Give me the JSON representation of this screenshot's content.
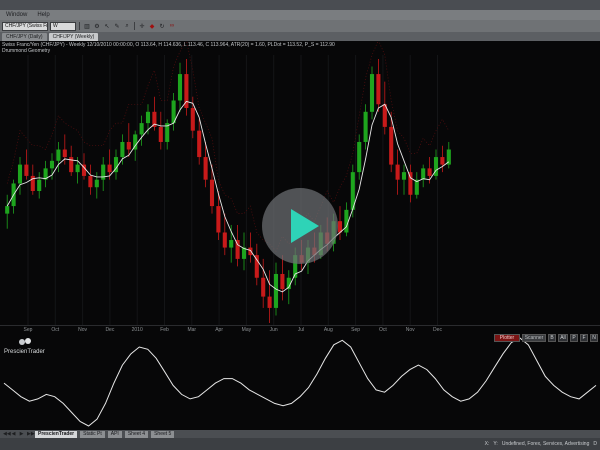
{
  "menu": {
    "items": [
      "Window",
      "Help"
    ]
  },
  "toolbar": {
    "symbol": "CHF/JPY (Swiss Fr",
    "interval": "W",
    "icons": [
      "chart-icon",
      "settings-icon",
      "pointer-icon",
      "drawing-icon",
      "zoom-icon",
      "crosshair-icon",
      "color-icon",
      "refresh-icon",
      "link-icon"
    ]
  },
  "tabs": [
    {
      "label": "CHF/JPY (Daily)"
    },
    {
      "label": "CHF/JPY (Weekly)"
    }
  ],
  "chart_header": {
    "line1": "Swiss Franc/Yen (CHF/JPY) - Weekly 12/10/2010 00:00:00, O 113.64, H 114.636, L 113.46, C 113.964, ATR(20) = 1.60, PLDot = 113.52, P_S = 112.90",
    "line2": "Drummond Geometry"
  },
  "date_axis": [
    "Sep",
    "Oct",
    "Nov",
    "Dec",
    "2010",
    "Feb",
    "Mar",
    "Apr",
    "May",
    "Jun",
    "Jul",
    "Aug",
    "Sep",
    "Oct",
    "Nov",
    "Dec"
  ],
  "panel_buttons": {
    "plotter": "Plotter",
    "scanner": "Scanner",
    "b": "B",
    "all": "All",
    "p": "P",
    "f": "F",
    "n": "N"
  },
  "logo_text": "PrescienTrader",
  "sheets": {
    "nav": [
      "◀◀",
      "◀",
      "▶",
      "▶▶"
    ],
    "tabs": [
      "PrescienTrader",
      "Static Pt",
      "API",
      "Sheet 4",
      "Sheet 5"
    ]
  },
  "status": {
    "x": "X:",
    "y": "Y:",
    "label": "Undefined, Forex, Services, Advertising",
    "end": "D"
  },
  "colors": {
    "bull": "#1ea51e",
    "bear": "#c81a1a",
    "background": "#070708",
    "accent_play": "#2ed3b7"
  },
  "chart_data": {
    "type": "candlestick",
    "candles": [
      {
        "o": 95,
        "h": 100,
        "l": 91,
        "c": 97
      },
      {
        "o": 97,
        "h": 104,
        "l": 95,
        "c": 103
      },
      {
        "o": 103,
        "h": 110,
        "l": 100,
        "c": 108
      },
      {
        "o": 108,
        "h": 112,
        "l": 104,
        "c": 105
      },
      {
        "o": 105,
        "h": 108,
        "l": 100,
        "c": 101
      },
      {
        "o": 101,
        "h": 106,
        "l": 99,
        "c": 104
      },
      {
        "o": 104,
        "h": 109,
        "l": 102,
        "c": 107
      },
      {
        "o": 107,
        "h": 111,
        "l": 104,
        "c": 109
      },
      {
        "o": 109,
        "h": 114,
        "l": 106,
        "c": 112
      },
      {
        "o": 112,
        "h": 116,
        "l": 108,
        "c": 110
      },
      {
        "o": 110,
        "h": 113,
        "l": 105,
        "c": 106
      },
      {
        "o": 106,
        "h": 110,
        "l": 103,
        "c": 108
      },
      {
        "o": 108,
        "h": 111,
        "l": 104,
        "c": 105
      },
      {
        "o": 105,
        "h": 108,
        "l": 100,
        "c": 102
      },
      {
        "o": 102,
        "h": 106,
        "l": 99,
        "c": 104
      },
      {
        "o": 104,
        "h": 110,
        "l": 101,
        "c": 108
      },
      {
        "o": 108,
        "h": 112,
        "l": 104,
        "c": 106
      },
      {
        "o": 106,
        "h": 112,
        "l": 104,
        "c": 110
      },
      {
        "o": 110,
        "h": 116,
        "l": 108,
        "c": 114
      },
      {
        "o": 114,
        "h": 119,
        "l": 110,
        "c": 112
      },
      {
        "o": 112,
        "h": 117,
        "l": 109,
        "c": 116
      },
      {
        "o": 116,
        "h": 121,
        "l": 113,
        "c": 119
      },
      {
        "o": 119,
        "h": 124,
        "l": 116,
        "c": 122
      },
      {
        "o": 122,
        "h": 126,
        "l": 117,
        "c": 118
      },
      {
        "o": 118,
        "h": 122,
        "l": 112,
        "c": 114
      },
      {
        "o": 114,
        "h": 120,
        "l": 112,
        "c": 119
      },
      {
        "o": 119,
        "h": 127,
        "l": 117,
        "c": 125
      },
      {
        "o": 125,
        "h": 135,
        "l": 122,
        "c": 132
      },
      {
        "o": 132,
        "h": 136,
        "l": 121,
        "c": 123
      },
      {
        "o": 123,
        "h": 126,
        "l": 115,
        "c": 117
      },
      {
        "o": 117,
        "h": 120,
        "l": 108,
        "c": 110
      },
      {
        "o": 110,
        "h": 114,
        "l": 102,
        "c": 104
      },
      {
        "o": 104,
        "h": 108,
        "l": 95,
        "c": 97
      },
      {
        "o": 97,
        "h": 101,
        "l": 88,
        "c": 90
      },
      {
        "o": 90,
        "h": 95,
        "l": 84,
        "c": 86
      },
      {
        "o": 86,
        "h": 92,
        "l": 82,
        "c": 88
      },
      {
        "o": 88,
        "h": 92,
        "l": 81,
        "c": 83
      },
      {
        "o": 83,
        "h": 90,
        "l": 80,
        "c": 86
      },
      {
        "o": 86,
        "h": 90,
        "l": 82,
        "c": 84
      },
      {
        "o": 84,
        "h": 87,
        "l": 76,
        "c": 78
      },
      {
        "o": 78,
        "h": 83,
        "l": 70,
        "c": 73
      },
      {
        "o": 73,
        "h": 80,
        "l": 66,
        "c": 70
      },
      {
        "o": 70,
        "h": 82,
        "l": 68,
        "c": 79
      },
      {
        "o": 79,
        "h": 84,
        "l": 72,
        "c": 75
      },
      {
        "o": 75,
        "h": 80,
        "l": 71,
        "c": 78
      },
      {
        "o": 78,
        "h": 86,
        "l": 76,
        "c": 84
      },
      {
        "o": 84,
        "h": 88,
        "l": 80,
        "c": 82
      },
      {
        "o": 82,
        "h": 88,
        "l": 79,
        "c": 86
      },
      {
        "o": 86,
        "h": 90,
        "l": 82,
        "c": 84
      },
      {
        "o": 84,
        "h": 92,
        "l": 83,
        "c": 90
      },
      {
        "o": 90,
        "h": 94,
        "l": 85,
        "c": 87
      },
      {
        "o": 87,
        "h": 95,
        "l": 85,
        "c": 93
      },
      {
        "o": 93,
        "h": 97,
        "l": 88,
        "c": 90
      },
      {
        "o": 90,
        "h": 98,
        "l": 89,
        "c": 96
      },
      {
        "o": 96,
        "h": 108,
        "l": 94,
        "c": 106
      },
      {
        "o": 106,
        "h": 116,
        "l": 104,
        "c": 114
      },
      {
        "o": 114,
        "h": 124,
        "l": 112,
        "c": 122
      },
      {
        "o": 122,
        "h": 134,
        "l": 120,
        "c": 132
      },
      {
        "o": 132,
        "h": 136,
        "l": 122,
        "c": 124
      },
      {
        "o": 124,
        "h": 130,
        "l": 116,
        "c": 118
      },
      {
        "o": 118,
        "h": 122,
        "l": 106,
        "c": 108
      },
      {
        "o": 108,
        "h": 112,
        "l": 100,
        "c": 104
      },
      {
        "o": 104,
        "h": 108,
        "l": 100,
        "c": 106
      },
      {
        "o": 106,
        "h": 108,
        "l": 98,
        "c": 100
      },
      {
        "o": 100,
        "h": 106,
        "l": 99,
        "c": 104
      },
      {
        "o": 104,
        "h": 108,
        "l": 102,
        "c": 107
      },
      {
        "o": 107,
        "h": 110,
        "l": 103,
        "c": 105
      },
      {
        "o": 105,
        "h": 112,
        "l": 104,
        "c": 110
      },
      {
        "o": 110,
        "h": 113,
        "l": 106,
        "c": 108
      },
      {
        "o": 108,
        "h": 114,
        "l": 107,
        "c": 112
      }
    ],
    "oscillator": [
      0.1,
      -0.2,
      -0.5,
      -0.7,
      -0.6,
      -0.4,
      -0.5,
      -0.8,
      -1.2,
      -1.6,
      -1.8,
      -1.5,
      -0.8,
      0.1,
      0.9,
      1.4,
      1.7,
      1.6,
      1.2,
      0.6,
      0.0,
      -0.4,
      -0.6,
      -0.5,
      -0.2,
      0.1,
      0.3,
      0.3,
      0.1,
      -0.2,
      -0.4,
      -0.6,
      -0.8,
      -0.9,
      -0.8,
      -0.5,
      -0.1,
      0.5,
      1.2,
      1.8,
      2.0,
      1.7,
      1.0,
      0.3,
      -0.2,
      -0.3,
      0.0,
      0.4,
      0.7,
      0.9,
      0.7,
      0.3,
      -0.2,
      -0.5,
      -0.7,
      -0.6,
      -0.3,
      0.2,
      0.8,
      1.4,
      1.9,
      2.1,
      1.8,
      1.1,
      0.4,
      0.0,
      -0.3,
      -0.5,
      -0.6,
      -0.3,
      0.0
    ]
  }
}
